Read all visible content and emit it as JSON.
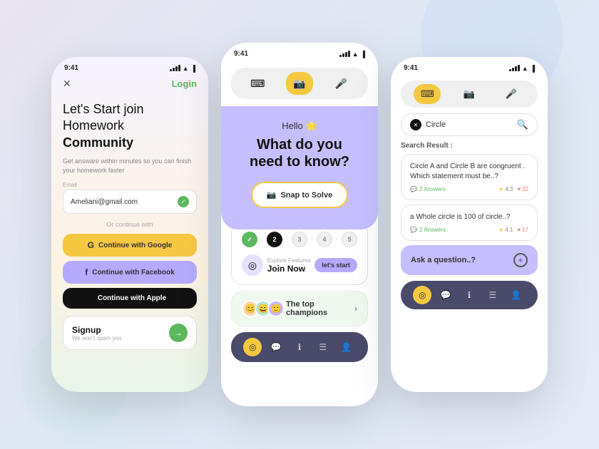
{
  "background": {
    "color": "#e4e8f5"
  },
  "phone1": {
    "status_time": "9:41",
    "close_btn": "✕",
    "login_btn": "Login",
    "headline": "Let's Start join\nHomework ",
    "headline_bold": "Community",
    "subtext": "Get answare within minutes so you can finish your homework faster",
    "email_label": "Email",
    "email_value": "Ameliani@gmail.com",
    "or_text": "Or continue with",
    "google_btn": "Continue with Google",
    "facebook_btn": "Continue with Facebook",
    "apple_btn": "Continue with Apple",
    "signup_title": "Signup",
    "signup_sub": "We won't spam you"
  },
  "phone2": {
    "status_time": "9:41",
    "hello_text": "Hello 🌟",
    "question_text": "What do you\nneed to know?",
    "snap_btn": "Snap to Solve",
    "explore_label": "Explore Features",
    "join_title": "Join Now",
    "lets_start": "let's start",
    "champions_text": "The top champions",
    "steps": [
      "✓",
      "2",
      "3",
      "4",
      "5"
    ]
  },
  "phone3": {
    "status_time": "9:41",
    "search_value": "Circle",
    "search_result_label": "Search Result :",
    "q1": "Circle A and Circle B are congruent .\nWhich statement must be..?",
    "q1_answers": "2 Answers",
    "q1_rating": "4.3",
    "q1_likes": "32",
    "q2": "a Whole circle is 100 of circle..?",
    "q2_answers": "2 Answers",
    "q2_rating": "4.1",
    "q2_likes": "17",
    "ask_text": "Ask a question..?"
  },
  "icons": {
    "camera": "📷",
    "keyboard": "⌨",
    "mic": "🎤",
    "google": "G",
    "facebook": "f",
    "apple": "",
    "check": "✓",
    "arrow_right": "→",
    "chevron_right": "›",
    "star": "★",
    "heart": "♥",
    "search": "🔍",
    "close": "✕",
    "plus": "+",
    "compass": "◎",
    "chat": "💬",
    "info": "ℹ",
    "list": "☰",
    "user": "👤"
  }
}
